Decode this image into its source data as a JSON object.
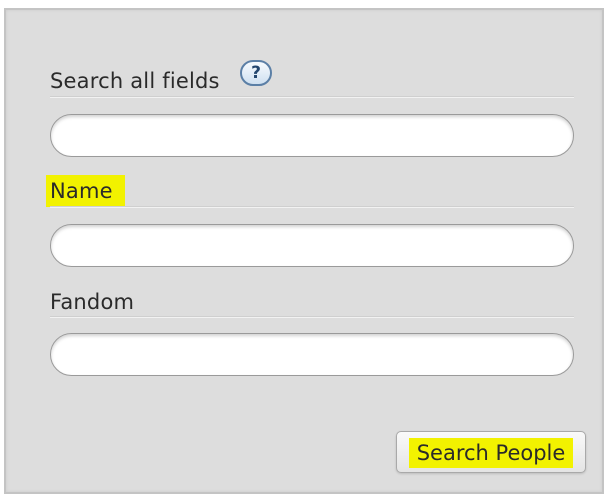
{
  "form": {
    "search_all": {
      "label": "Search all fields",
      "help_icon": "help-icon",
      "help_text": "?",
      "value": ""
    },
    "name": {
      "label": "Name",
      "highlighted": true,
      "value": ""
    },
    "fandom": {
      "label": "Fandom",
      "value": ""
    },
    "submit": {
      "label": "Search People",
      "highlighted": true
    }
  },
  "colors": {
    "panel_bg": "#dddddd",
    "highlight": "#f2f200",
    "help_border": "#5b7fa6"
  }
}
